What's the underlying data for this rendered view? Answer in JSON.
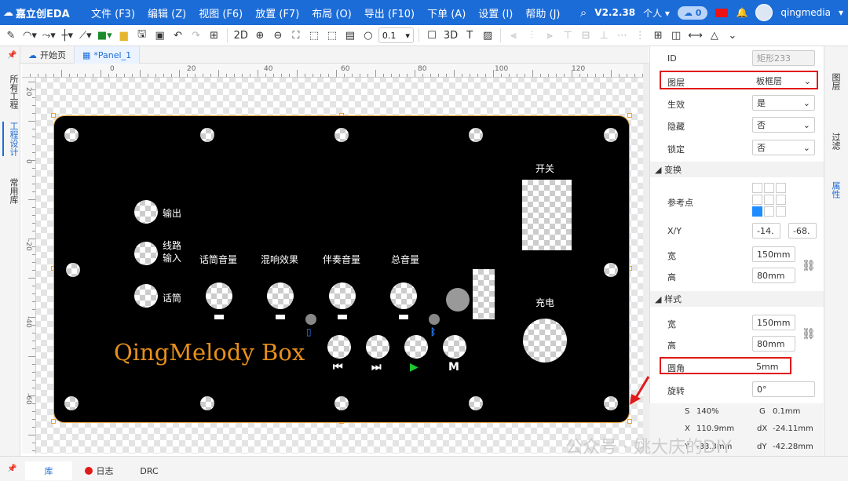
{
  "app": {
    "logo": "嘉立创EDA",
    "version": "V2.2.38",
    "user": "qingmedia",
    "personal": "个人",
    "cloud_count": "0"
  },
  "menu": [
    "文件 (F3)",
    "编辑 (Z)",
    "视图 (F6)",
    "放置 (F7)",
    "布局 (O)",
    "导出 (F10)",
    "下单 (A)",
    "设置 (I)",
    "帮助 (J)"
  ],
  "toolbar": {
    "grid_value": "0.1",
    "view_2d": "2D",
    "view_3d": "3D"
  },
  "left_tabs": [
    "所有工程",
    "工程设计",
    "常用库"
  ],
  "tabs": [
    "开始页",
    "*Panel_1"
  ],
  "ruler_top": [
    "0",
    "20",
    "40",
    "60",
    "80",
    "100",
    "120"
  ],
  "ruler_left": [
    "20",
    "0",
    "-20",
    "-40",
    "-60"
  ],
  "board": {
    "brand": "QingMelody Box",
    "labels": {
      "output": "输出",
      "line_in": "线路\n输入",
      "mic": "话筒",
      "mic_vol": "话筒音量",
      "reverb": "混响效果",
      "accomp_vol": "伴奏音量",
      "master_vol": "总音量",
      "switch": "开关",
      "charge": "充电"
    },
    "symbols": {
      "prev": "⏮",
      "next": "⏭",
      "play": "▶",
      "mode": "M",
      "battery": "▯",
      "bluetooth": "ᛒ"
    }
  },
  "properties": {
    "id_label": "ID",
    "id_value": "矩形233",
    "layer_label": "图层",
    "layer_value": "板框层",
    "effect_label": "生效",
    "effect_value": "是",
    "hidden_label": "隐藏",
    "hidden_value": "否",
    "locked_label": "锁定",
    "locked_value": "否",
    "transform_section": "变换",
    "ref_label": "参考点",
    "xy_label": "X/Y",
    "x_value": "-14.",
    "y_value": "-68.",
    "width_label": "宽",
    "width_value": "150mm",
    "height_label": "高",
    "height_value": "80mm",
    "style_section": "样式",
    "style_width_value": "150mm",
    "style_height_value": "80mm",
    "corner_label": "圆角",
    "corner_value": "5mm",
    "rotate_label": "旋转",
    "rotate_value": "0°"
  },
  "right_tabs": [
    "图层",
    "过滤",
    "属性"
  ],
  "status": {
    "s": "S",
    "s_val": "140%",
    "g": "G",
    "g_val": "0.1mm",
    "x": "X",
    "x_val": "110.9mm",
    "dx": "dX",
    "dx_val": "-24.11mm",
    "y": "Y",
    "y_val": "-33.3mm",
    "dy": "dY",
    "dy_val": "-42.28mm"
  },
  "bottom_tabs": [
    "库",
    "日志",
    "DRC"
  ],
  "watermark": "公众号 · 姚大庆的DIY",
  "colors": {
    "accent": "#1c6cd8",
    "board": "#000000",
    "outline": "#e8a23a",
    "brand_text": "#e8901a",
    "highlight": "#e01919"
  }
}
